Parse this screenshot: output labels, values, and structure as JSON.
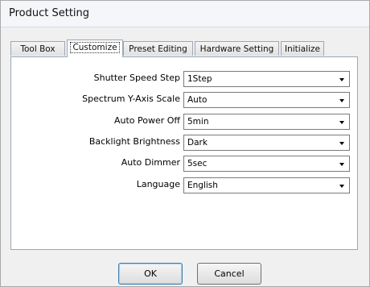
{
  "window": {
    "title": "Product Setting"
  },
  "tabs": [
    {
      "label": "Tool Box"
    },
    {
      "label": "Customize"
    },
    {
      "label": "Preset Editing"
    },
    {
      "label": "Hardware Setting"
    },
    {
      "label": "Initialize"
    }
  ],
  "active_tab": "Customize",
  "settings": [
    {
      "label": "Shutter Speed Step",
      "value": "1Step"
    },
    {
      "label": "Spectrum Y-Axis Scale",
      "value": "Auto"
    },
    {
      "label": "Auto Power Off",
      "value": "5min"
    },
    {
      "label": "Backlight Brightness",
      "value": "Dark"
    },
    {
      "label": "Auto Dimmer",
      "value": "5sec"
    },
    {
      "label": "Language",
      "value": "English"
    }
  ],
  "buttons": {
    "ok": "OK",
    "cancel": "Cancel"
  }
}
